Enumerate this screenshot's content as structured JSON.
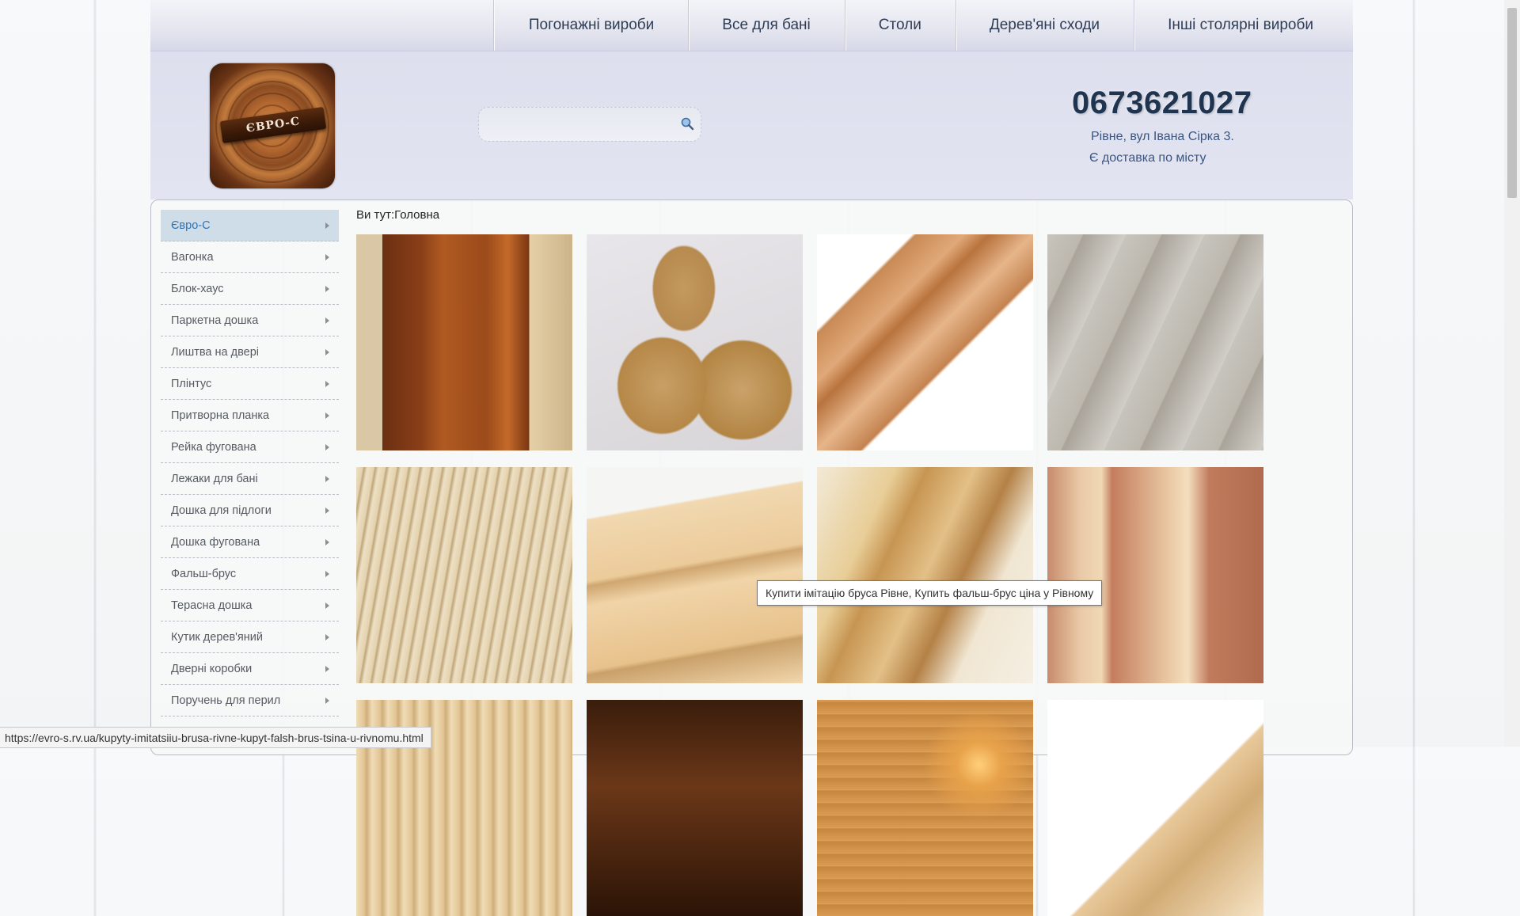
{
  "nav": {
    "items": [
      "Погонажні вироби",
      "Все для бані",
      "Столи",
      "Дерев'яні сходи",
      "Інші столярні вироби"
    ]
  },
  "header": {
    "logo_text": "ЄВРО-С",
    "search": {
      "value": "",
      "placeholder": ""
    },
    "phone": "0673621027",
    "address": "Рівне, вул Івана Сірка 3.",
    "delivery": "Є доставка по місту"
  },
  "sidebar": {
    "items": [
      {
        "label": "Євро-С",
        "active": true
      },
      {
        "label": "Вагонка"
      },
      {
        "label": "Блок-хаус"
      },
      {
        "label": "Паркетна дошка"
      },
      {
        "label": "Лиштва на двері"
      },
      {
        "label": "Плінтус"
      },
      {
        "label": "Притворна планка"
      },
      {
        "label": "Рейка фугована"
      },
      {
        "label": "Лежаки для бані"
      },
      {
        "label": "Дошка для підлоги"
      },
      {
        "label": "Дошка фугована"
      },
      {
        "label": "Фальш-брус"
      },
      {
        "label": "Терасна дошка"
      },
      {
        "label": "Кутик дерев'яний"
      },
      {
        "label": "Дверні коробки"
      },
      {
        "label": "Поручень для перил"
      }
    ]
  },
  "breadcrumb": "Ви тут:Головна",
  "tiles": [
    {
      "name": "staircase-photo"
    },
    {
      "name": "handrail-profile-photo"
    },
    {
      "name": "wooden-corner-photo"
    },
    {
      "name": "parquet-board-photo"
    },
    {
      "name": "floor-board-stack-photo"
    },
    {
      "name": "planed-board-photo"
    },
    {
      "name": "false-beam-photo"
    },
    {
      "name": "wooden-slat-photo"
    },
    {
      "name": "lining-board-photo"
    },
    {
      "name": "dark-wood-photo"
    },
    {
      "name": "sauna-interior-photo"
    },
    {
      "name": "skirting-photo"
    }
  ],
  "tooltip": "Купити імітацію бруса Рівне, Купить фальш-брус ціна у Рівному",
  "status_url": "https://evro-s.rv.ua/kupyty-imitatsiiu-brusa-rivne-kupyt-falsh-brus-tsina-u-rivnomu.html",
  "colors": {
    "link_active": "#2f73b5",
    "phone": "#1e3450",
    "header_bg": "#dddfee"
  }
}
